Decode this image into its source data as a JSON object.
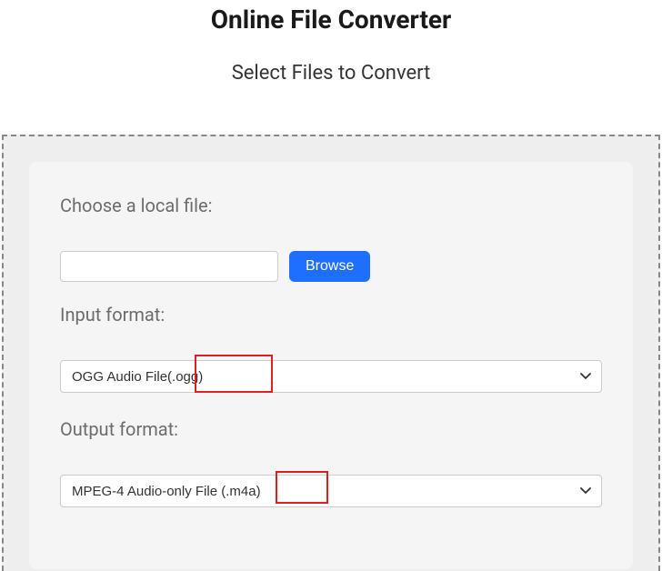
{
  "header": {
    "title": "Online File Converter",
    "subtitle": "Select Files to Convert"
  },
  "form": {
    "choose_label": "Choose a local file:",
    "browse_label": "Browse",
    "file_value": "",
    "input_format_label": "Input format:",
    "input_format_value": "OGG Audio File(.ogg)",
    "output_format_label": "Output format:",
    "output_format_value": "MPEG-4 Audio-only File (.m4a)"
  }
}
